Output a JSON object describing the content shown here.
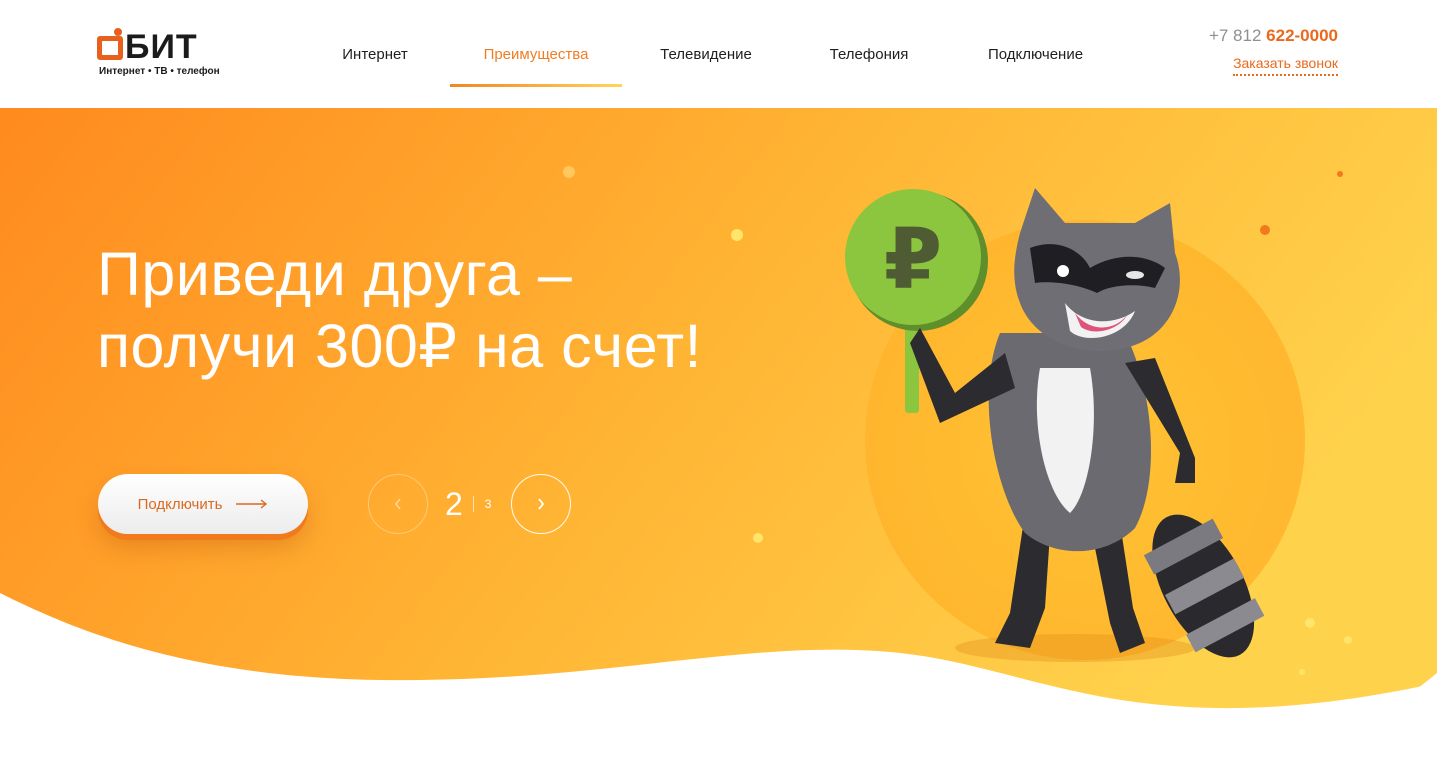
{
  "header": {
    "logo": {
      "name": "БИТ",
      "tagline": "Интернет • ТВ • телефон"
    },
    "nav": [
      {
        "label": "Интернет",
        "active": false
      },
      {
        "label": "Преимущества",
        "active": true
      },
      {
        "label": "Телевидение",
        "active": false
      },
      {
        "label": "Телефония",
        "active": false
      },
      {
        "label": "Подключение",
        "active": false
      }
    ],
    "phone_prefix": "+7 812",
    "phone_number": "622-0000",
    "callback_label": "Заказать звонок"
  },
  "hero": {
    "title_line1": "Приведи друга –",
    "title_line2": "получи 300₽ на счет!",
    "cta_label": "Подключить",
    "slider": {
      "current": "2",
      "next": "3"
    },
    "sign_symbol": "₽"
  },
  "colors": {
    "accent": "#e9691d",
    "hero_orange": "#ff8f1f",
    "hero_yellow": "#ffd04a",
    "sign_green": "#8cc63f"
  }
}
